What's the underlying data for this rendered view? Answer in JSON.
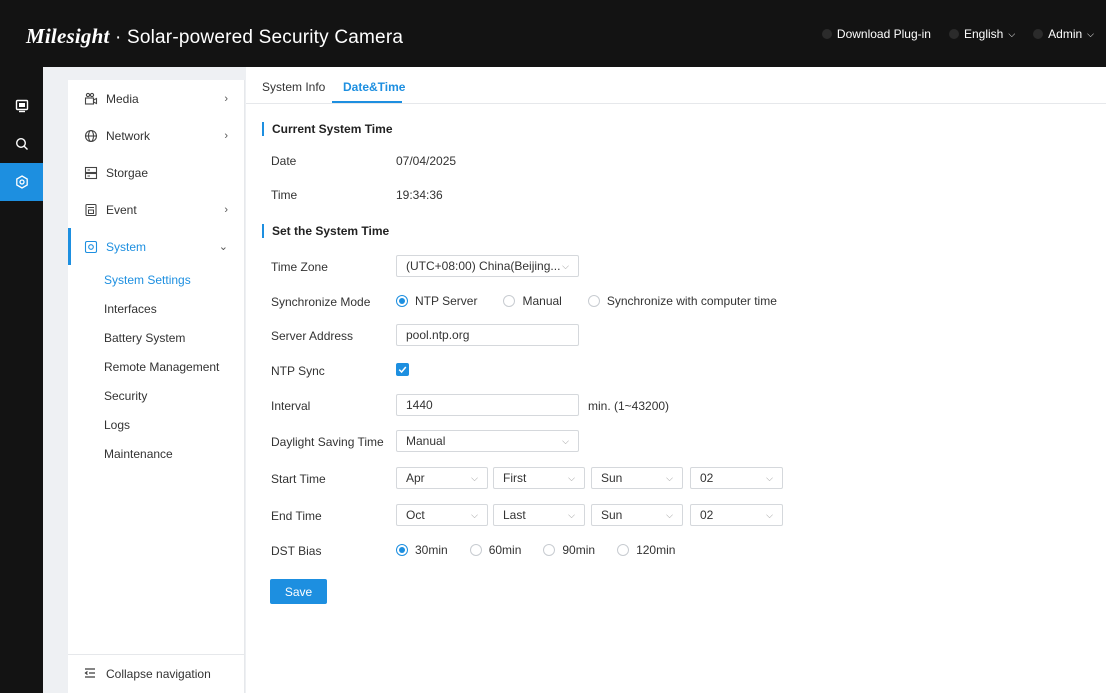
{
  "header": {
    "logo": "Milesight",
    "separator": "·",
    "title": "Solar-powered Security Camera",
    "download_plugin": "Download Plug-in",
    "language": "English",
    "user": "Admin"
  },
  "colors": {
    "accent": "#1d8fe0",
    "topbar": "#131313"
  },
  "iconbar": [
    {
      "icon": "live-view-icon",
      "active": false
    },
    {
      "icon": "search-icon",
      "active": false
    },
    {
      "icon": "settings-icon",
      "active": true
    }
  ],
  "sidebar": {
    "items": [
      {
        "label": "Media",
        "icon": "media-icon",
        "arrow": "›"
      },
      {
        "label": "Network",
        "icon": "globe-icon",
        "arrow": "›"
      },
      {
        "label": "Storgae",
        "icon": "storage-icon",
        "arrow": ""
      },
      {
        "label": "Event",
        "icon": "event-icon",
        "arrow": "›"
      },
      {
        "label": "System",
        "icon": "system-icon",
        "arrow": "⌄"
      }
    ],
    "subitems": [
      "System Settings",
      "Interfaces",
      "Battery System",
      "Remote Management",
      "Security",
      "Logs",
      "Maintenance"
    ],
    "collapse": "Collapse navigation"
  },
  "tabs": [
    "System Info",
    "Date&Time"
  ],
  "current": {
    "title": "Current System Time",
    "date_label": "Date",
    "date_value": "07/04/2025",
    "time_label": "Time",
    "time_value": "19:34:36"
  },
  "set": {
    "title": "Set the System Time",
    "timezone_label": "Time Zone",
    "timezone_value": "(UTC+08:00) China(Beijing...",
    "sync_label": "Synchronize Mode",
    "sync_options": [
      "NTP Server",
      "Manual",
      "Synchronize with computer time"
    ],
    "server_label": "Server Address",
    "server_value": "pool.ntp.org",
    "ntp_label": "NTP Sync",
    "interval_label": "Interval",
    "interval_value": "1440",
    "interval_hint": "min. (1~43200)",
    "dst_label": "Daylight Saving Time",
    "dst_value": "Manual",
    "start_label": "Start Time",
    "start_values": [
      "Apr",
      "First",
      "Sun",
      "02"
    ],
    "end_label": "End Time",
    "end_values": [
      "Oct",
      "Last",
      "Sun",
      "02"
    ],
    "bias_label": "DST Bias",
    "bias_options": [
      "30min",
      "60min",
      "90min",
      "120min"
    ],
    "save_label": "Save"
  }
}
